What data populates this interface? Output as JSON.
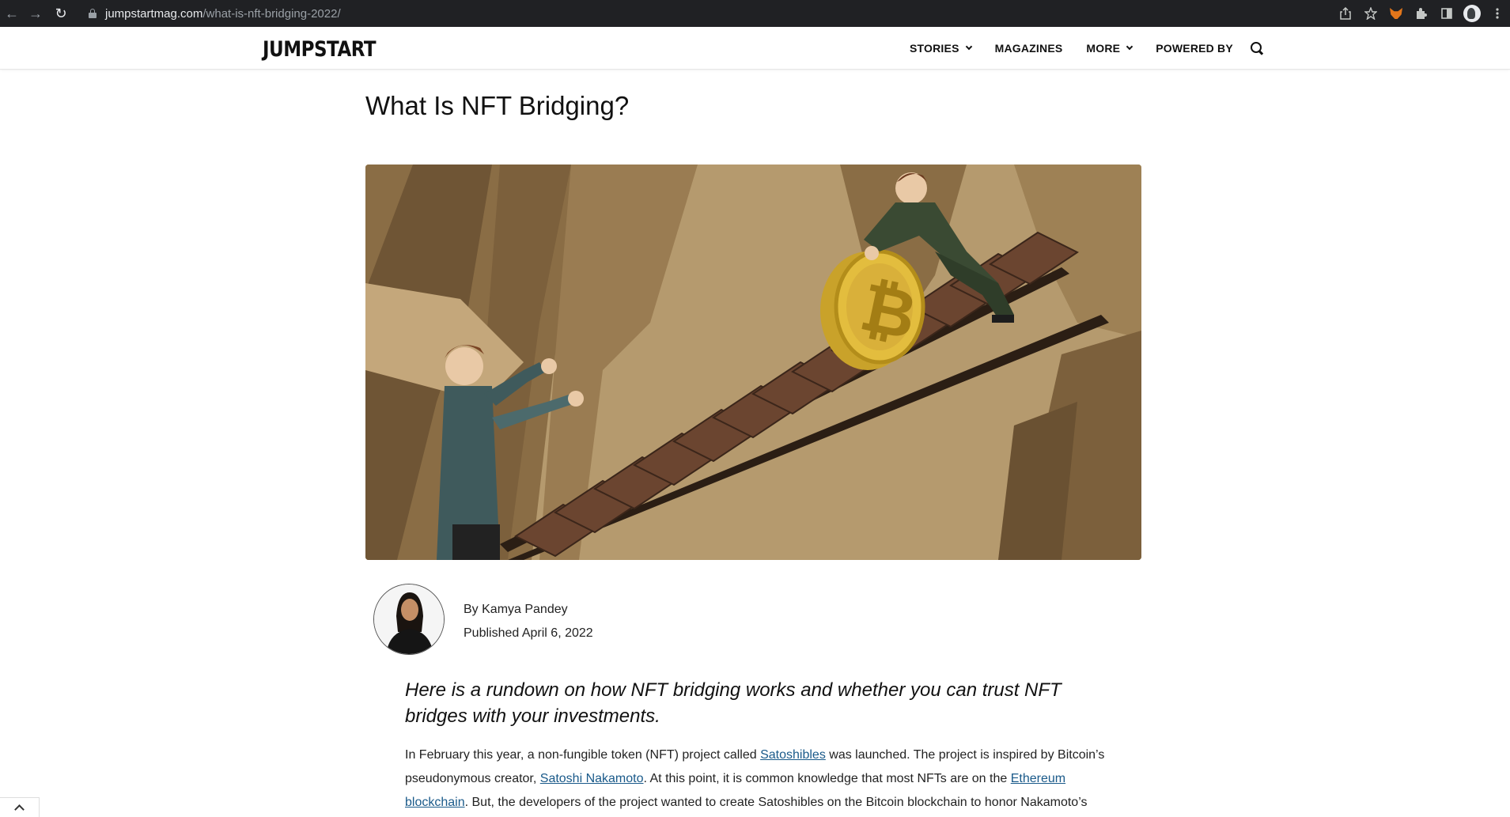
{
  "browser": {
    "url_host": "jumpstartmag.com",
    "url_path": "/what-is-nft-bridging-2022/",
    "icons": [
      "back-icon",
      "forward-icon",
      "reload-icon",
      "lock-icon",
      "share-icon",
      "star-icon",
      "metamask-icon",
      "extensions-icon",
      "sidepanel-icon",
      "profile-icon",
      "menu-icon"
    ]
  },
  "site": {
    "logo": "JUMPSTART",
    "menu": {
      "stories": "STORIES",
      "magazines": "MAGAZINES",
      "more": "MORE",
      "powered_by": "POWERED BY"
    }
  },
  "article": {
    "title": "What Is NFT Bridging?",
    "author": "By Kamya Pandey",
    "published": "Published April 6, 2022",
    "lede": "Here is a rundown on how NFT bridging works and whether you can trust NFT bridges with your investments.",
    "p1": {
      "t1": "In February this year, a non-fungible token (NFT) project called ",
      "link1": "Satoshibles",
      "t2": " was launched. The project is inspired by Bitcoin’s pseudonymous creator, ",
      "link2": "Satoshi Nakamoto",
      "t3": ". At this point, it is common knowledge that most NFTs are on the ",
      "link3": "Ethereum blockchain",
      "t4": ". But, the developers of the project wanted to create Satoshibles on the Bitcoin blockchain to honor Nakamoto’s"
    }
  },
  "colors": {
    "chrome_bg": "#202124",
    "link": "#1a5a8a",
    "hero_sky": "#b59a6e"
  }
}
